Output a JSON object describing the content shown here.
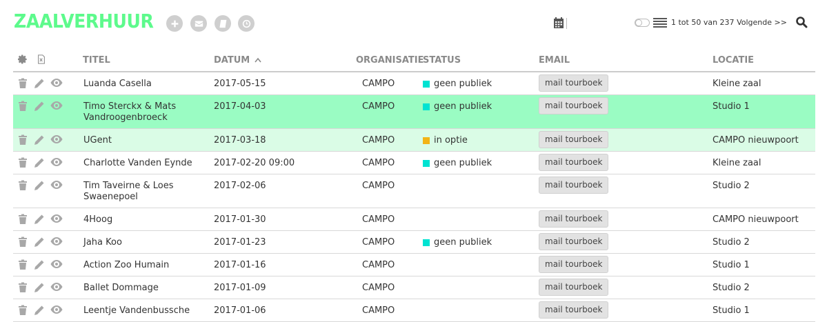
{
  "app": {
    "title": "ZAALVERHUUR",
    "accent_color": "#5dfa8c",
    "toolbar_icons": [
      "plus-icon",
      "mail-icon",
      "book-icon",
      "clock-icon"
    ]
  },
  "pager": {
    "range_text": "1 tot 50 van 237",
    "next_label": "Volgende >>"
  },
  "table": {
    "headers": {
      "actions_icon": "gear-icon",
      "export_icon": "excel-icon",
      "title": "TITEL",
      "date": "DATUM",
      "date_sort": "^",
      "organisation": "ORGANISATIE",
      "status": "STATUS",
      "email": "EMAIL",
      "location": "LOCATIE"
    },
    "status_colors": {
      "geen publiek": "#00e3d2",
      "in optie": "#f2b416"
    },
    "row_highlight_colors": {
      "green": "#9afcc3",
      "light": "#dafce6"
    },
    "rows": [
      {
        "title": "Luanda Casella",
        "date": "2017-05-15",
        "organisation": "CAMPO",
        "status": "geen publiek",
        "email": "mail tourboek",
        "location": "Kleine zaal"
      },
      {
        "title": "Timo Sterckx & Mats Vandroogenbroeck",
        "date": "2017-04-03",
        "organisation": "CAMPO",
        "status": "geen publiek",
        "email": "mail tourboek",
        "location": "Studio 1"
      },
      {
        "title": "UGent",
        "date": "2017-03-18",
        "organisation": "CAMPO",
        "status": "in optie",
        "email": "mail tourboek",
        "location": "CAMPO nieuwpoort"
      },
      {
        "title": "Charlotte Vanden Eynde",
        "date": "2017-02-20 09:00",
        "organisation": "CAMPO",
        "status": "geen publiek",
        "email": "mail tourboek",
        "location": "Kleine zaal"
      },
      {
        "title": "Tim Taveirne & Loes Swaenepoel",
        "date": "2017-02-06",
        "organisation": "CAMPO",
        "status": "",
        "email": "mail tourboek",
        "location": "Studio 2"
      },
      {
        "title": "4Hoog",
        "date": "2017-01-30",
        "organisation": "CAMPO",
        "status": "",
        "email": "mail tourboek",
        "location": "CAMPO nieuwpoort"
      },
      {
        "title": "Jaha Koo",
        "date": "2017-01-23",
        "organisation": "CAMPO",
        "status": "geen publiek",
        "email": "mail tourboek",
        "location": "Studio 2"
      },
      {
        "title": "Action Zoo Humain",
        "date": "2017-01-16",
        "organisation": "CAMPO",
        "status": "",
        "email": "mail tourboek",
        "location": "Studio 1"
      },
      {
        "title": "Ballet Dommage",
        "date": "2017-01-09",
        "organisation": "CAMPO",
        "status": "",
        "email": "mail tourboek",
        "location": "Studio 2"
      },
      {
        "title": "Leentje Vandenbussche",
        "date": "2017-01-06",
        "organisation": "CAMPO",
        "status": "",
        "email": "mail tourboek",
        "location": "Studio 1"
      }
    ]
  }
}
